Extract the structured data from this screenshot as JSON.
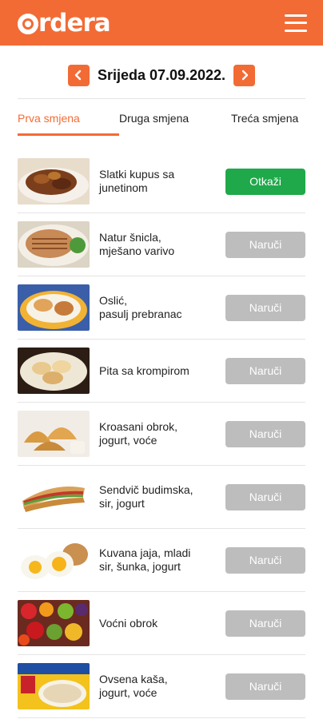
{
  "header": {
    "logo_text": "rdera",
    "brand_color": "#f26b35",
    "menu_icon": "hamburger-menu-icon"
  },
  "date_nav": {
    "date_label": "Srijeda 07.09.2022.",
    "prev_icon": "chevron-left-icon",
    "next_icon": "chevron-right-icon"
  },
  "tabs": [
    {
      "label": "Prva smjena",
      "active": true
    },
    {
      "label": "Druga smjena",
      "active": false
    },
    {
      "label": "Treća smjena",
      "active": false
    }
  ],
  "meals": [
    {
      "name": "Slatki kupus sa\njunetinom",
      "action": "Otkaži",
      "status_color": "#1fa94a"
    },
    {
      "name": "Natur šnicla,\nmješano varivo",
      "action": "Naruči",
      "status_color": "#bdbdbd"
    },
    {
      "name": "Oslić,\npasulj prebranac",
      "action": "Naruči",
      "status_color": "#bdbdbd"
    },
    {
      "name": "Pita sa krompirom",
      "action": "Naruči",
      "status_color": "#bdbdbd"
    },
    {
      "name": "Kroasani obrok,\njogurt, voće",
      "action": "Naruči",
      "status_color": "#bdbdbd"
    },
    {
      "name": "Sendvič budimska,\nsir, jogurt",
      "action": "Naruči",
      "status_color": "#bdbdbd"
    },
    {
      "name": "Kuvana jaja, mladi\nsir, šunka, jogurt",
      "action": "Naruči",
      "status_color": "#bdbdbd"
    },
    {
      "name": "Voćni obrok",
      "action": "Naruči",
      "status_color": "#bdbdbd"
    },
    {
      "name": "Ovsena kaša,\njogurt, voće",
      "action": "Naruči",
      "status_color": "#bdbdbd"
    }
  ]
}
